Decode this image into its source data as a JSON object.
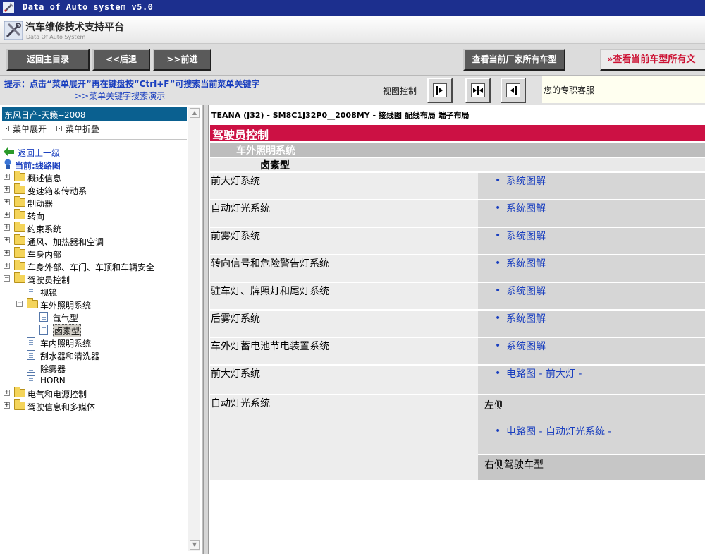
{
  "window": {
    "title": "Data of Auto system v5.0"
  },
  "header": {
    "title_cn": "汽车维修技术支持平台",
    "title_en": "Data Of Auto System"
  },
  "toolbar": {
    "home": "返回主目录",
    "back": "<<后退",
    "forward": ">>前进",
    "all_vendor_models": "查看当前厂家所有车型",
    "all_current_models": "查看当前车型所有文"
  },
  "hint": {
    "text": "提示：点击“菜单展开”再在键盘按“Ctrl+F”可搜索当前菜单关键字",
    "demo_link": ">>菜单关键字搜索演示",
    "view_control": "视图控制",
    "service": "您的专职客服"
  },
  "sidebar": {
    "vehicle": "东风日产-天籁--2008",
    "expand": "菜单展开",
    "collapse": "菜单折叠",
    "back_link": "返回上一级",
    "current": "当前:线路图",
    "tree": [
      {
        "label": "概述信息"
      },
      {
        "label": "变速箱＆传动系"
      },
      {
        "label": "制动器"
      },
      {
        "label": "转向"
      },
      {
        "label": "约束系统"
      },
      {
        "label": "通风、加热器和空调"
      },
      {
        "label": "车身内部"
      },
      {
        "label": "车身外部、车门、车顶和车辆安全"
      },
      {
        "label": "驾驶员控制"
      },
      {
        "label": "视镜"
      },
      {
        "label": "车外照明系统"
      },
      {
        "label": "氙气型"
      },
      {
        "label": "卤素型"
      },
      {
        "label": "车内照明系统"
      },
      {
        "label": "刮水器和清洗器"
      },
      {
        "label": "除雾器"
      },
      {
        "label": "HORN"
      },
      {
        "label": "电气和电源控制"
      },
      {
        "label": "驾驶信息和多媒体"
      }
    ]
  },
  "content": {
    "breadcrumb": "TEANA (J32) - SM8C1J32P0__2008MY - 接线图 配线布局 端子布局",
    "section": "驾驶员控制",
    "subsection": "车外照明系统",
    "subsubsection": "卤素型",
    "rows": [
      {
        "name": "前大灯系统",
        "link": "系统图解"
      },
      {
        "name": "自动灯光系统",
        "link": "系统图解"
      },
      {
        "name": "前雾灯系统",
        "link": "系统图解"
      },
      {
        "name": "转向信号和危险警告灯系统",
        "link": "系统图解"
      },
      {
        "name": "驻车灯、牌照灯和尾灯系统",
        "link": "系统图解"
      },
      {
        "name": "后雾灯系统",
        "link": "系统图解"
      },
      {
        "name": "车外灯蓄电池节电装置系统",
        "link": "系统图解"
      },
      {
        "name": "前大灯系统",
        "link": "电路图 - 前大灯 -"
      },
      {
        "name": "自动灯光系统",
        "sub_left": "左侧",
        "link": "电路图 - 自动灯光系统 -",
        "sub_right": "右侧驾驶车型"
      }
    ]
  }
}
